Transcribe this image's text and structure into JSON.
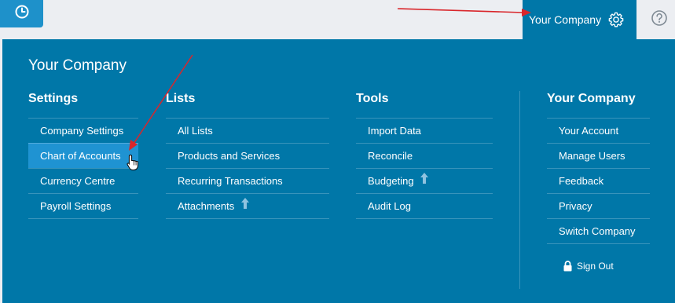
{
  "colors": {
    "accent": "#0077a8",
    "highlight": "#1f93d2",
    "clock_button": "#1e91ca",
    "topbar": "#eceef2",
    "annotation_arrow": "#d9262b"
  },
  "topbar": {
    "clock_icon": "clock-icon",
    "company_label": "Your Company",
    "gear_icon": "gear-icon",
    "help_icon": "help-icon"
  },
  "menu": {
    "title": "Your Company",
    "settings": {
      "heading": "Settings",
      "items": [
        {
          "label": "Company Settings"
        },
        {
          "label": "Chart of Accounts",
          "active": true
        },
        {
          "label": "Currency Centre"
        },
        {
          "label": "Payroll Settings"
        }
      ]
    },
    "lists": {
      "heading": "Lists",
      "items": [
        {
          "label": "All Lists"
        },
        {
          "label": "Products and Services"
        },
        {
          "label": "Recurring Transactions"
        },
        {
          "label": "Attachments",
          "icon": "upgrade-arrow-icon"
        }
      ]
    },
    "tools": {
      "heading": "Tools",
      "items": [
        {
          "label": "Import Data"
        },
        {
          "label": "Reconcile"
        },
        {
          "label": "Budgeting",
          "icon": "upgrade-arrow-icon"
        },
        {
          "label": "Audit Log"
        }
      ]
    },
    "your_company": {
      "heading": "Your Company",
      "items": [
        {
          "label": "Your Account"
        },
        {
          "label": "Manage Users"
        },
        {
          "label": "Feedback"
        },
        {
          "label": "Privacy"
        },
        {
          "label": "Switch Company"
        }
      ]
    },
    "sign_out": {
      "label": "Sign Out",
      "icon": "lock-icon"
    }
  }
}
